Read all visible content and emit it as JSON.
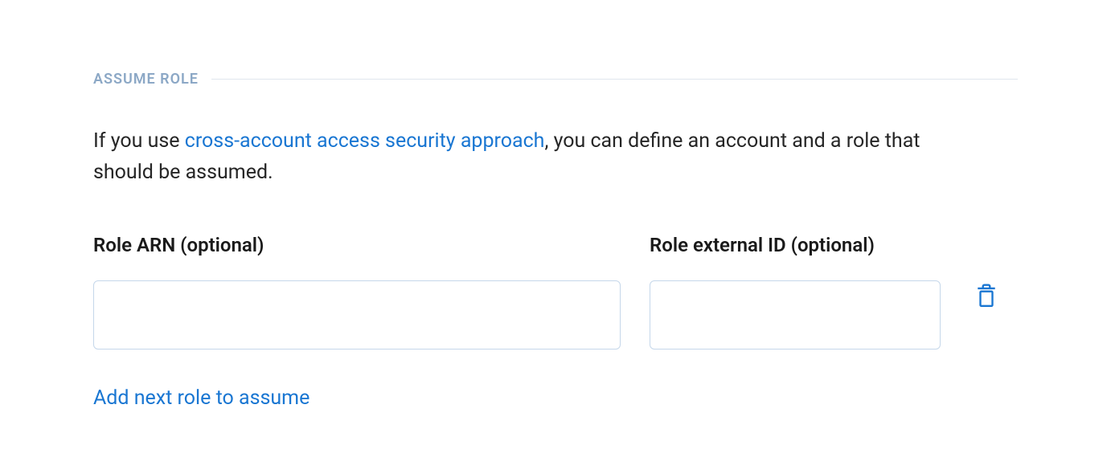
{
  "section": {
    "heading": "ASSUME ROLE",
    "description_pre": "If you use ",
    "description_link": "cross-account access security approach",
    "description_post": ", you can define an account and a role that should be assumed."
  },
  "fields": {
    "role_arn": {
      "label": "Role ARN (optional)",
      "value": ""
    },
    "role_external_id": {
      "label": "Role external ID (optional)",
      "value": ""
    }
  },
  "actions": {
    "add_next": "Add next role to assume"
  }
}
